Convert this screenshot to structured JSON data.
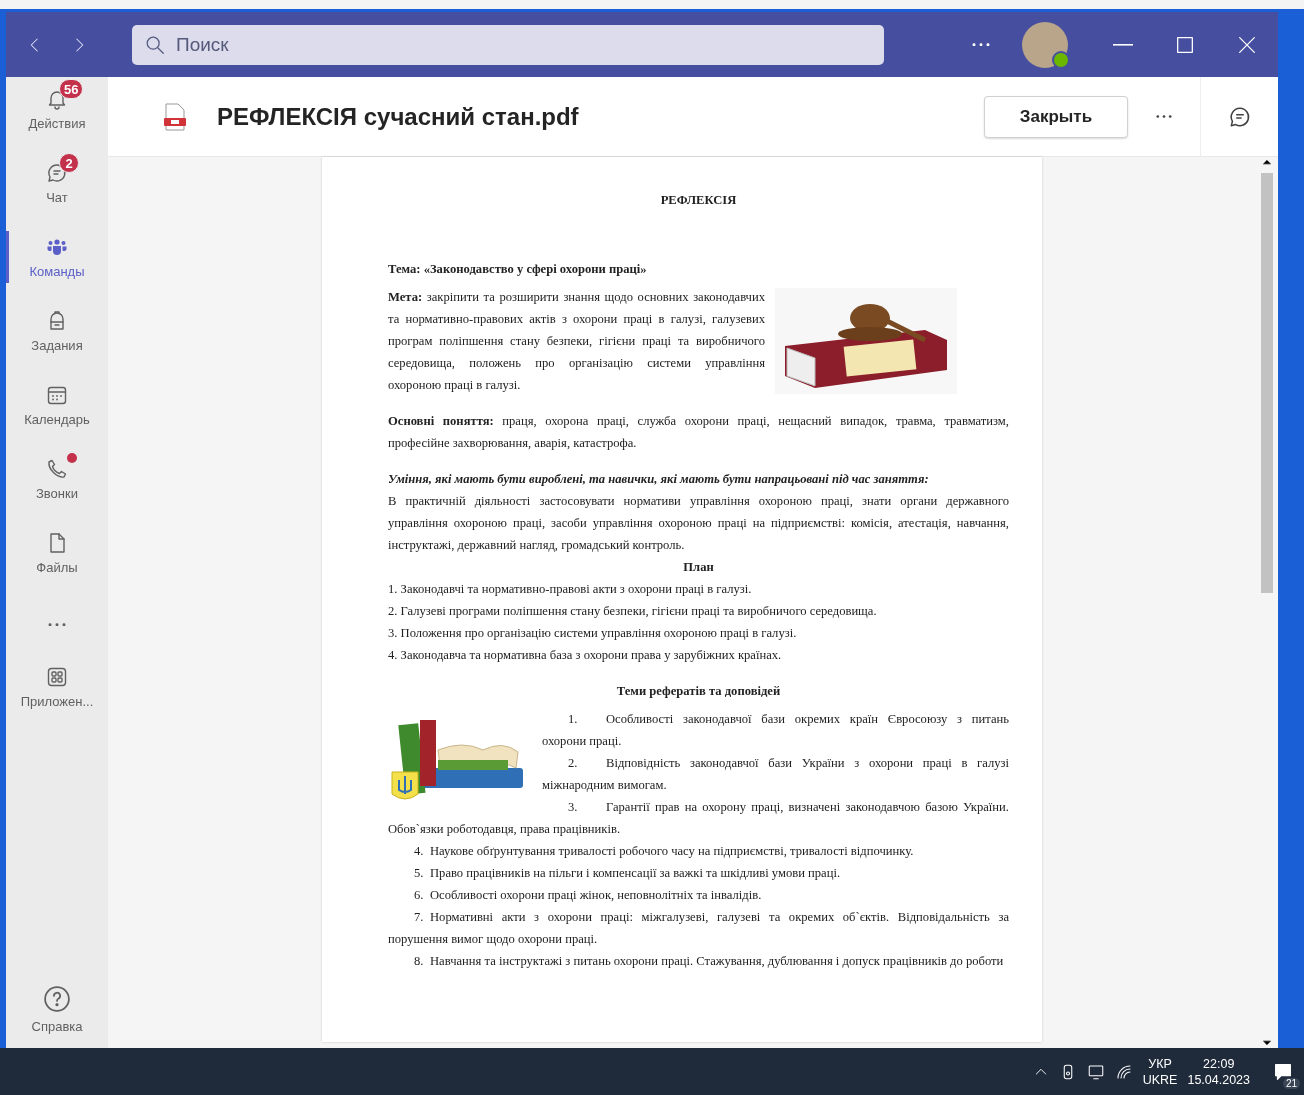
{
  "title_bar": {
    "search_placeholder": "Поиск"
  },
  "sidebar": {
    "items": [
      {
        "kind": "activity",
        "label": "Действия",
        "badge": "56",
        "selected": false,
        "dot": false
      },
      {
        "kind": "chat",
        "label": "Чат",
        "badge": "2",
        "selected": false,
        "dot": false
      },
      {
        "kind": "teams",
        "label": "Команды",
        "selected": true,
        "dot": false
      },
      {
        "kind": "assignments",
        "label": "Задания",
        "selected": false,
        "dot": false
      },
      {
        "kind": "calendar",
        "label": "Календарь",
        "selected": false,
        "dot": false
      },
      {
        "kind": "calls",
        "label": "Звонки",
        "selected": false,
        "dot": true
      },
      {
        "kind": "files",
        "label": "Файлы",
        "selected": false,
        "dot": false
      },
      {
        "kind": "more",
        "selected": false,
        "dot": false
      },
      {
        "kind": "apps",
        "label": "Приложен...",
        "selected": false,
        "dot": false
      }
    ],
    "help": {
      "label": "Справка"
    }
  },
  "file_header": {
    "title": "РЕФЛЕКСІЯ сучасний стан.pdf",
    "close_button": "Закрыть"
  },
  "document": {
    "heading": "РЕФЛЕКСІЯ",
    "topic": "Тема: «Законодавство у сфері охорони праці»",
    "goal": "**Мета:** закріпити та розширити знання щодо основних законодавчих та нормативно-правових актів з охорони праці в галузі, галузевих програм поліпшення стану безпеки, гігієни праці та виробничого середовища, положень про організацію системи управління охороною праці в галузі.",
    "concepts": "**Основні поняття:** праця, охорона праці, служба охорони праці, нещасний випадок, травма, травматизм, професійне захворювання, аварія, катастрофа.",
    "skills_heading": "Уміння, які мають бути вироблені, та навички, які мають бути напрацьовані під час заняття:",
    "skills_text": "В практичній діяльності застосовувати нормативи управління охороною праці, знати органи державного управління охороною праці, засоби управління охороною праці на підприємстві: комісія, атестація, навчання, інструктажі, державний нагляд, громадський контроль.",
    "plan_heading": "План",
    "plan_items": [
      "1. Законодавчі та нормативно-правові акти з охорони праці в галузі.",
      "2. Галузеві програми поліпшення стану безпеки, гігієни праці та виробничого середовища.",
      "3. Положення про організацію системи управління охороною праці в галузі.",
      "4. Законодавча та нормативна база з охорони права у зарубіжних країнах."
    ],
    "topics_heading": "Теми рефератів та доповідей",
    "topics": [
      {
        "number": "1.",
        "text": "Особливості законодавчої бази окремих країн Євросоюзу з питань охорони праці."
      },
      {
        "number": "2.",
        "text": "Відповідність законодавчої бази України з охорони праці в галузі міжнародним вимогам."
      },
      {
        "number": "3.",
        "text": "Гарантії прав на охорону праці, визначені законодавчою базою України. Обов`язки роботодавця, права працівників."
      },
      {
        "number": "4.",
        "text": "Наукове обґрунтування тривалості робочого часу на підприємстві, тривалості відпочинку."
      },
      {
        "number": "5.",
        "text": "Право працівників на пільги і компенсації за важкі та шкідливі умови праці."
      },
      {
        "number": "6.",
        "text": "Особливості охорони праці жінок, неповнолітніх та інвалідів."
      },
      {
        "number": "7.",
        "text": "Нормативні акти з охорони праці: міжгалузеві, галузеві та окремих об`єктів. Відповідальність за порушення вимог щодо охорони праці."
      },
      {
        "number": "8.",
        "text": "Навчання та інструктажі з питань охорони праці. Стажування, дублювання і допуск працівників до роботи"
      }
    ]
  },
  "taskbar": {
    "language": "УКР",
    "layout": "UKRE",
    "time": "22:09",
    "date": "15.04.2023",
    "notifications": "21"
  }
}
